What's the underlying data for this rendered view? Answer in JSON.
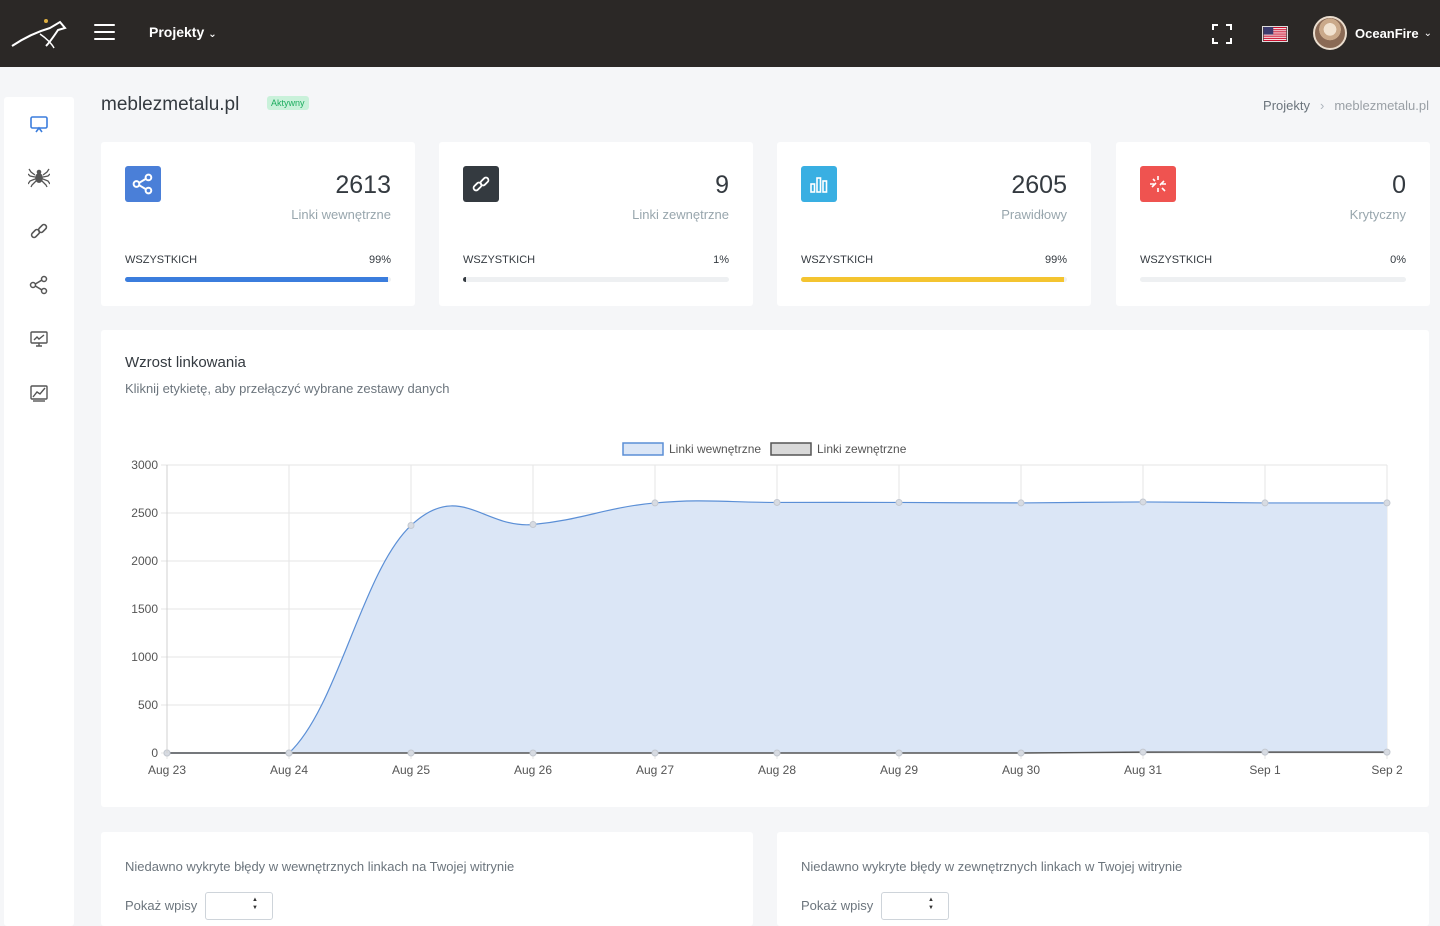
{
  "topbar": {
    "projects_label": "Projekty",
    "user_name": "OceanFire",
    "language": "en-US flag"
  },
  "header": {
    "title": "meblezmetalu.pl",
    "status": "Aktywny",
    "breadcrumb": [
      "Projekty",
      "meblezmetalu.pl"
    ]
  },
  "sidebar": {
    "items": [
      "monitor-icon",
      "spider-icon",
      "link-icon",
      "share-icon",
      "dashboard-icon",
      "chart-icon"
    ]
  },
  "cards": [
    {
      "value": "2613",
      "label": "Linki wewnętrzne",
      "all": "WSZYSTKICH",
      "percent": "99%",
      "fill": 0.99,
      "color": "#3b7ddd",
      "icon": "share-icon",
      "icon_bg": "#4a7fd8"
    },
    {
      "value": "9",
      "label": "Linki zewnętrzne",
      "all": "WSZYSTKICH",
      "percent": "1%",
      "fill": 0.01,
      "color": "#343a40",
      "icon": "link-icon",
      "icon_bg": "#343a40"
    },
    {
      "value": "2605",
      "label": "Prawidłowy",
      "all": "WSZYSTKICH",
      "percent": "99%",
      "fill": 0.99,
      "color": "#f4c430",
      "icon": "bar-chart-icon",
      "icon_bg": "#39afe2"
    },
    {
      "value": "0",
      "label": "Krytyczny",
      "all": "WSZYSTKICH",
      "percent": "0%",
      "fill": 0.0,
      "color": "#f06060",
      "icon": "broken-link-icon",
      "icon_bg": "#ef5350"
    }
  ],
  "chart": {
    "title": "Wzrost linkowania",
    "subtitle": "Kliknij etykietę, aby przełączyć wybrane zestawy danych"
  },
  "chart_data": {
    "type": "line",
    "title": "Wzrost linkowania",
    "categories": [
      "Aug 23",
      "Aug 24",
      "Aug 25",
      "Aug 26",
      "Aug 27",
      "Aug 28",
      "Aug 29",
      "Aug 30",
      "Aug 31",
      "Sep 1",
      "Sep 2"
    ],
    "series": [
      {
        "name": "Linki wewnętrzne",
        "values": [
          0,
          0,
          2370,
          2380,
          2605,
          2610,
          2610,
          2605,
          2615,
          2605,
          2605
        ],
        "color": "#5b8fd6",
        "fill": "#dbe6f6"
      },
      {
        "name": "Linki zewnętrzne",
        "values": [
          0,
          0,
          0,
          0,
          0,
          0,
          0,
          0,
          9,
          9,
          9
        ],
        "color": "#555555",
        "fill": "#d9d9d9"
      }
    ],
    "yticks": [
      0,
      500,
      1000,
      1500,
      2000,
      2500,
      3000
    ],
    "ylim": [
      0,
      3000
    ],
    "legend": "top-center",
    "grid": true
  },
  "tables": [
    {
      "title": "Niedawno wykryte błędy w wewnętrznych linkach na Twojej witrynie",
      "show_label": "Pokaż wpisy"
    },
    {
      "title": "Niedawno wykryte błędy w zewnętrznych linkach w Twojej witrynie",
      "show_label": "Pokaż wpisy"
    }
  ]
}
